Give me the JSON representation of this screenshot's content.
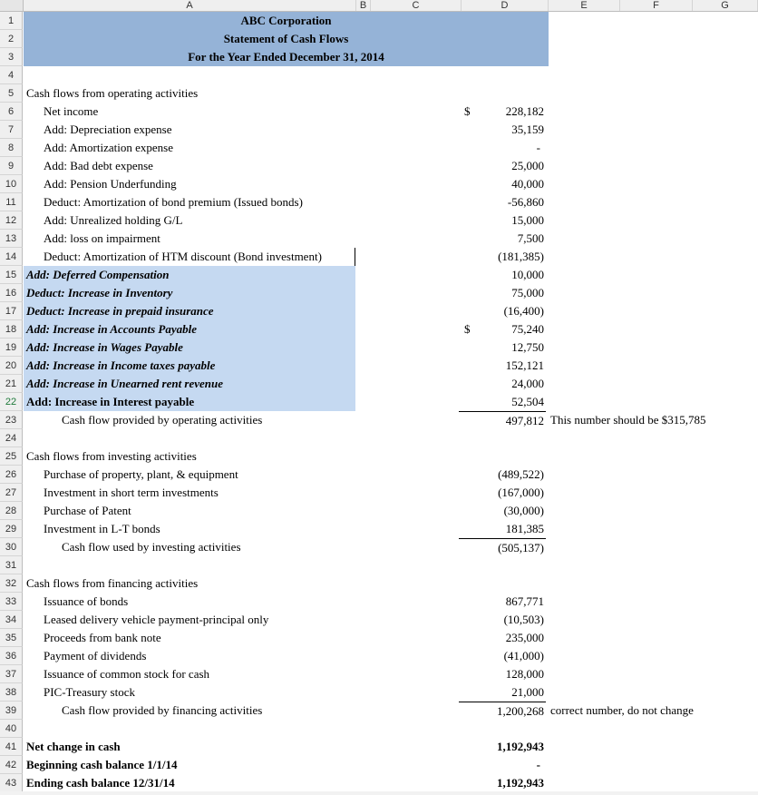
{
  "columns": [
    "A",
    "B",
    "C",
    "D",
    "E",
    "F",
    "G"
  ],
  "title": {
    "company": "ABC Corporation",
    "statement": "Statement of Cash Flows",
    "period": "For the Year Ended December 31, 2014"
  },
  "rows": {
    "r5": {
      "label": "Cash flows from operating activities"
    },
    "r6": {
      "label": "Net income",
      "dollar": "$",
      "value": "228,182"
    },
    "r7": {
      "label": "Add: Depreciation expense",
      "value": "35,159"
    },
    "r8": {
      "label": "Add: Amortization expense",
      "value": "-"
    },
    "r9": {
      "label": "Add: Bad debt expense",
      "value": "25,000"
    },
    "r10": {
      "label": "Add: Pension Underfunding",
      "value": "40,000"
    },
    "r11": {
      "label": "Deduct: Amortization of bond premium (Issued bonds)",
      "value": "-56,860"
    },
    "r12": {
      "label": "Add: Unrealized holding G/L",
      "value": "15,000"
    },
    "r13": {
      "label": "Add: loss on impairment",
      "value": "7,500"
    },
    "r14": {
      "label": "Deduct: Amortization of HTM discount (Bond investment)",
      "value": "(181,385)"
    },
    "r15": {
      "label": "Add: Deferred Compensation",
      "value": "10,000"
    },
    "r16": {
      "label": "Deduct: Increase in Inventory",
      "value": "75,000"
    },
    "r17": {
      "label": "Deduct: Increase in prepaid insurance",
      "value": "(16,400)"
    },
    "r18": {
      "label": "Add: Increase in Accounts Payable",
      "dollar": "$",
      "value": "75,240"
    },
    "r19": {
      "label": "Add: Increase in Wages Payable",
      "value": "12,750"
    },
    "r20": {
      "label": "Add: Increase in Income taxes payable",
      "value": "152,121"
    },
    "r21": {
      "label": "Add: Increase in Unearned rent revenue",
      "value": "24,000"
    },
    "r22": {
      "label": "Add: Increase in Interest payable",
      "value": "52,504"
    },
    "r23": {
      "label": "Cash flow provided by operating activities",
      "value": "497,812",
      "note": "This number should be $315,785"
    },
    "r25": {
      "label": "Cash flows from investing activities"
    },
    "r26": {
      "label": "Purchase of property, plant, & equipment",
      "value": "(489,522)"
    },
    "r27": {
      "label": "Investment in short term investments",
      "value": "(167,000)"
    },
    "r28": {
      "label": "Purchase of Patent",
      "value": "(30,000)"
    },
    "r29": {
      "label": "Investment in L-T bonds",
      "value": "181,385"
    },
    "r30": {
      "label": "Cash flow used by investing activities",
      "value": "(505,137)"
    },
    "r32": {
      "label": "Cash flows from financing activities"
    },
    "r33": {
      "label": "Issuance of bonds",
      "value": "867,771"
    },
    "r34": {
      "label": "Leased delivery vehicle payment-principal only",
      "value": "(10,503)"
    },
    "r35": {
      "label": "Proceeds from bank note",
      "value": "235,000"
    },
    "r36": {
      "label": "Payment of dividends",
      "value": "(41,000)"
    },
    "r37": {
      "label": "Issuance of common stock for cash",
      "value": "128,000"
    },
    "r38": {
      "label": "PIC-Treasury stock",
      "value": "21,000"
    },
    "r39": {
      "label": "Cash flow provided by financing activities",
      "value": "1,200,268",
      "note": "correct number, do not change"
    },
    "r41": {
      "label": "Net change in cash",
      "value": "1,192,943"
    },
    "r42": {
      "label": "Beginning cash balance 1/1/14",
      "value": "-"
    },
    "r43": {
      "label": "Ending cash balance 12/31/14",
      "value": "1,192,943"
    }
  },
  "colors": {
    "title_band": "#95b3d7",
    "highlight_band": "#c5d9f1",
    "header_bg": "#efefef"
  }
}
